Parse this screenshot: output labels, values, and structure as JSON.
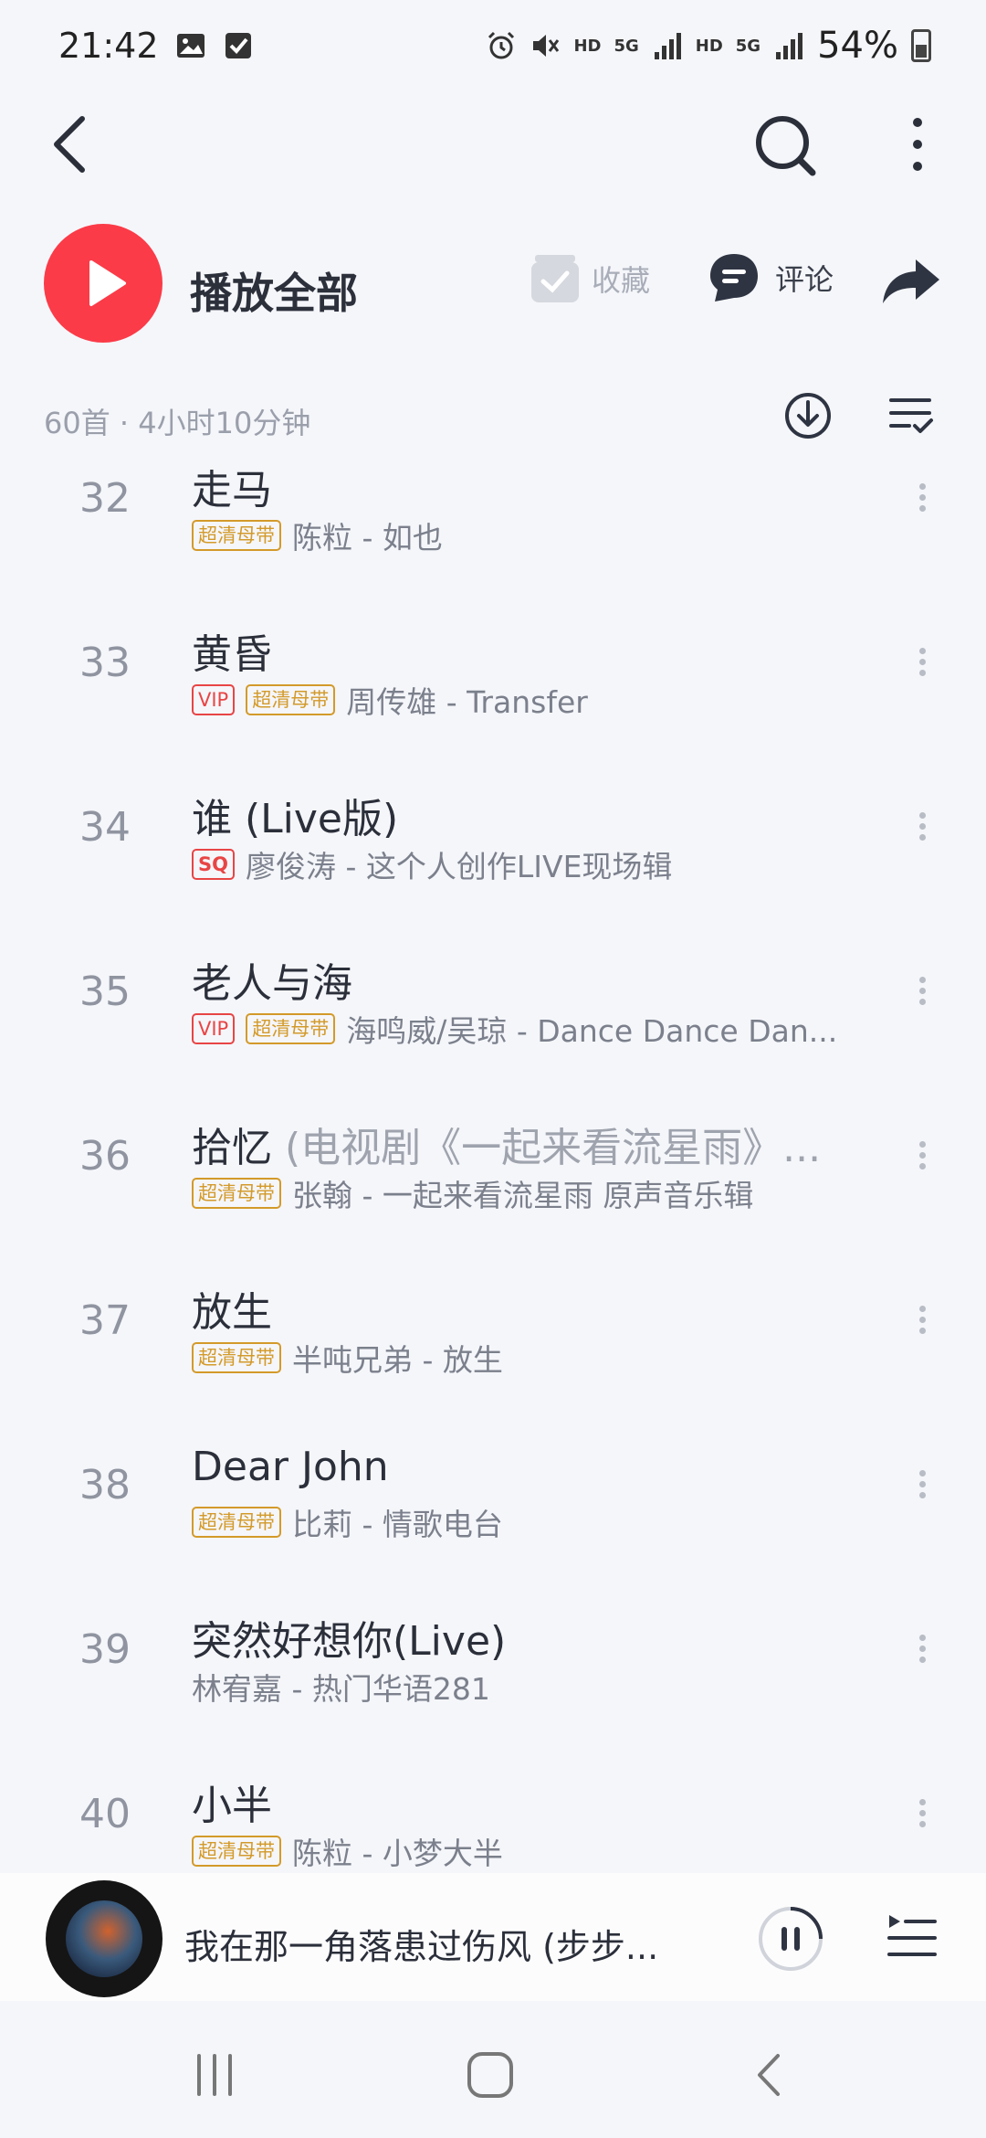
{
  "status": {
    "time": "21:42",
    "battery": "54%",
    "hd1": "HD",
    "hd2": "HD",
    "net1": "5G",
    "net2": "5G"
  },
  "actions": {
    "play_all": "播放全部",
    "collect": "收藏",
    "comment": "评论"
  },
  "list": {
    "summary": "60首 · 4小时10分钟",
    "songs": [
      {
        "index": "32",
        "title": "走马",
        "sub": "",
        "tags": [
          "超清母带"
        ],
        "artist": "陈粒 - 如也"
      },
      {
        "index": "33",
        "title": "黄昏",
        "sub": "",
        "tags": [
          "VIP",
          "超清母带"
        ],
        "artist": "周传雄 - Transfer"
      },
      {
        "index": "34",
        "title": "谁 (Live版)",
        "sub": "",
        "tags": [
          "SQ"
        ],
        "artist": "廖俊涛 - 这个人创作LIVE现场辑"
      },
      {
        "index": "35",
        "title": "老人与海",
        "sub": "",
        "tags": [
          "VIP",
          "超清母带"
        ],
        "artist": "海鸣威/吴琼 - Dance Dance Dan..."
      },
      {
        "index": "36",
        "title": "拾忆",
        "sub": " (电视剧《一起来看流星雨》...",
        "tags": [
          "超清母带"
        ],
        "artist": "张翰 - 一起来看流星雨 原声音乐辑"
      },
      {
        "index": "37",
        "title": "放生",
        "sub": "",
        "tags": [
          "超清母带"
        ],
        "artist": "半吨兄弟 - 放生"
      },
      {
        "index": "38",
        "title": "Dear John",
        "sub": "",
        "tags": [
          "超清母带"
        ],
        "artist": "比莉 - 情歌电台"
      },
      {
        "index": "39",
        "title": "突然好想你(Live)",
        "sub": "",
        "tags": [],
        "artist": "林宥嘉 - 热门华语281"
      },
      {
        "index": "40",
        "title": "小半",
        "sub": "",
        "tags": [
          "超清母带"
        ],
        "artist": "陈粒 - 小梦大半"
      }
    ]
  },
  "player": {
    "title": "我在那一角落患过伤风 (步步..."
  }
}
